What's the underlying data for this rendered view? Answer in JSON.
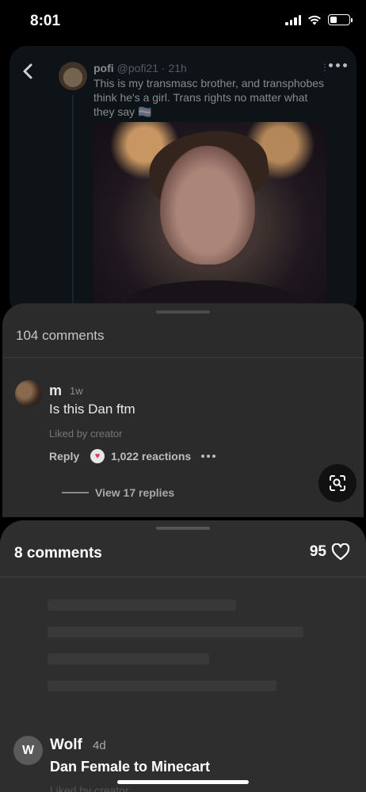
{
  "status_bar": {
    "time": "8:01",
    "battery_level": 0.35
  },
  "post": {
    "author_name": "pofi",
    "author_handle_time": "@pofi21 · 21h",
    "text": "This is my transmasc brother, and transphobes think he's a girl. Trans rights no matter what they say 🏳️‍⚧️",
    "icons": {
      "back": "chevron-left-icon",
      "more": "ellipsis-icon"
    }
  },
  "comments_sheet_1": {
    "title": "104 comments",
    "comment": {
      "user": "m",
      "time": "1w",
      "text": "Is this Dan ftm",
      "liked_by": "Liked by creator",
      "reply_label": "Reply",
      "reactions": "1,022 reactions",
      "view_replies": "View 17 replies"
    }
  },
  "comments_sheet_2": {
    "title": "8 comments",
    "likes": "95",
    "comment": {
      "avatar_letter": "W",
      "user": "Wolf",
      "time": "4d",
      "text": "Dan Female to Minecart",
      "liked_by": "Liked by creator"
    }
  }
}
